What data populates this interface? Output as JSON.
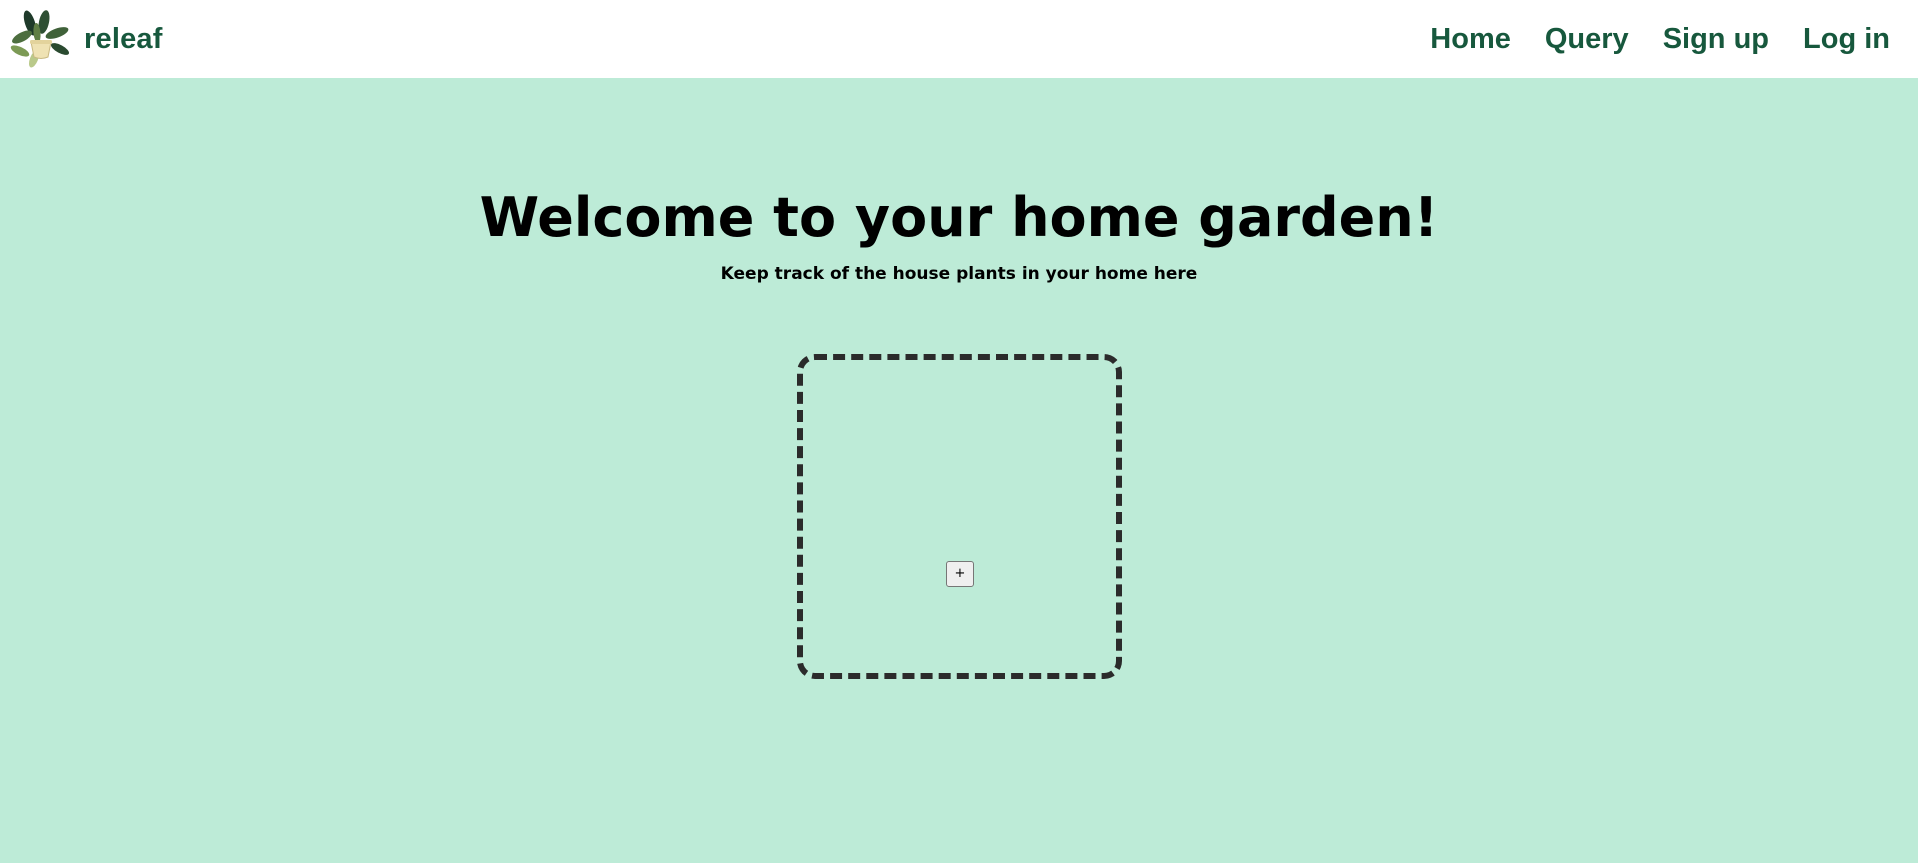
{
  "navbar": {
    "brand": "releaf",
    "logo_icon": "potted-plant-icon",
    "links": [
      {
        "label": "Home"
      },
      {
        "label": "Query"
      },
      {
        "label": "Sign up"
      },
      {
        "label": "Log in"
      }
    ]
  },
  "hero": {
    "title": "Welcome to your home garden!",
    "subtitle": "Keep track of the house plants in your home here"
  },
  "garden": {
    "add_button_label": "+"
  },
  "colors": {
    "background": "#bdebd7",
    "navbar_background": "#ffffff",
    "brand_green": "#17583d",
    "dashed_border": "#2b2b2b"
  }
}
